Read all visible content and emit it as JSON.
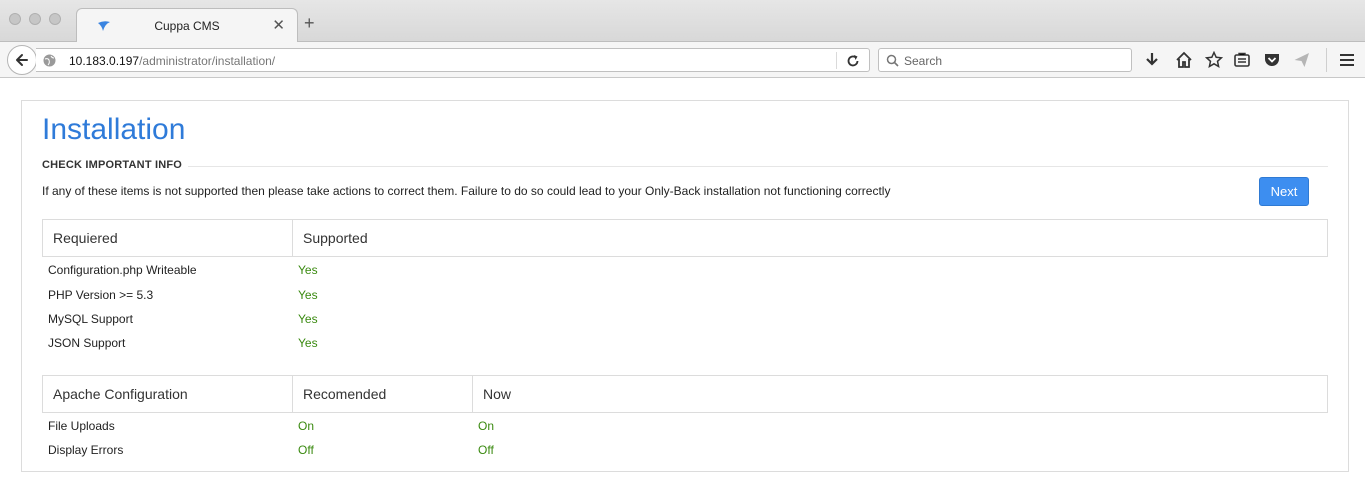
{
  "browser": {
    "tab": {
      "title": "Cuppa CMS"
    },
    "url": {
      "host": "10.183.0.197",
      "path": "/administrator/installation/"
    },
    "search": {
      "placeholder": "Search"
    }
  },
  "page": {
    "title": "Installation",
    "section_label": "CHECK IMPORTANT INFO",
    "info_text": "If any of these items is not supported then please take actions to correct them. Failure to do so could lead to your Only-Back installation not functioning correctly",
    "next_label": "Next",
    "requirements": {
      "headers": [
        "Requiered",
        "Supported"
      ],
      "rows": [
        {
          "label": "Configuration.php Writeable",
          "value": "Yes"
        },
        {
          "label": "PHP Version >= 5.3",
          "value": "Yes"
        },
        {
          "label": "MySQL Support",
          "value": "Yes"
        },
        {
          "label": "JSON Support",
          "value": "Yes"
        }
      ]
    },
    "apache": {
      "headers": [
        "Apache Configuration",
        "Recomended",
        "Now"
      ],
      "rows": [
        {
          "label": "File Uploads",
          "recommended": "On",
          "now": "On"
        },
        {
          "label": "Display Errors",
          "recommended": "Off",
          "now": "Off"
        }
      ]
    }
  },
  "colors": {
    "accent": "#2f7bd9",
    "button": "#3d8ef0",
    "status_ok": "#3a8a10"
  },
  "icons": [
    "back-arrow-icon",
    "globe-icon",
    "reload-icon",
    "search-icon",
    "download-icon",
    "home-icon",
    "bookmark-star-icon",
    "reading-list-icon",
    "pocket-icon",
    "send-icon",
    "menu-icon"
  ]
}
